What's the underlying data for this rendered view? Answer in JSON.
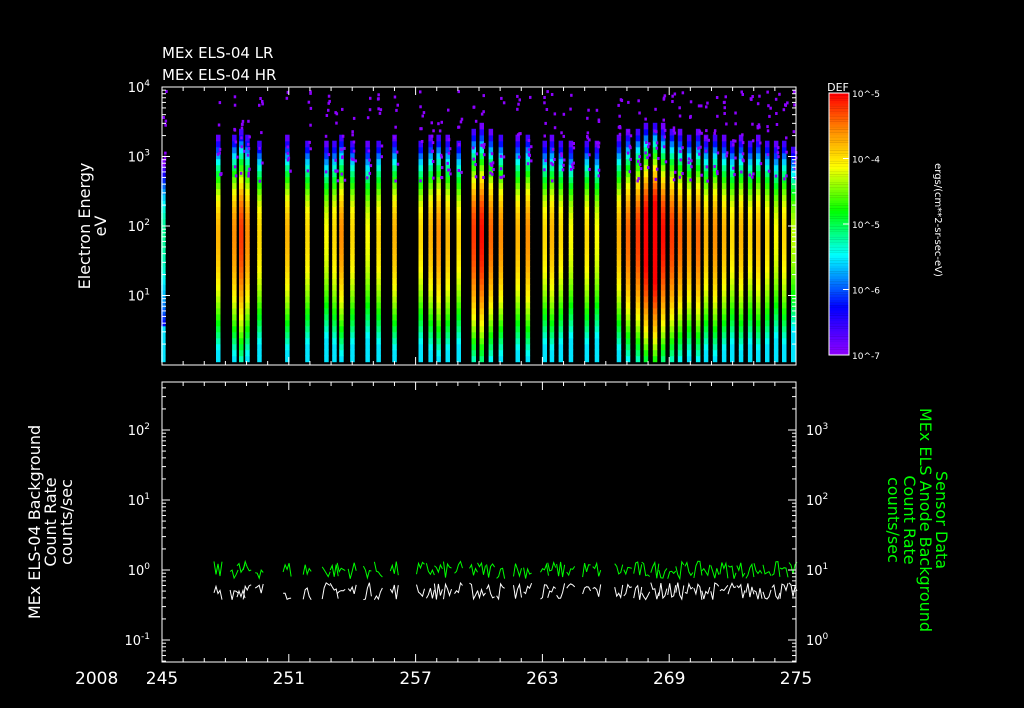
{
  "chart_data": [
    {
      "type": "heatmap",
      "title_lines": [
        "MEx ELS-04 LR",
        "MEx ELS-04 HR"
      ],
      "ylabel": "Electron Energy",
      "yunits": "eV",
      "yscale": "log",
      "ylim": [
        1,
        10000
      ],
      "yticks": [
        {
          "v": 10,
          "m": "10",
          "e": "1"
        },
        {
          "v": 100,
          "m": "10",
          "e": "2"
        },
        {
          "v": 1000,
          "m": "10",
          "e": "3"
        },
        {
          "v": 10000,
          "m": "10",
          "e": "4"
        }
      ],
      "xlim": [
        245,
        275
      ],
      "colorbar": {
        "title": "DEF",
        "units": "ergs/(cm**2-sr-sec-eV)",
        "scale": "log",
        "range": [
          1e-07,
          1e-05
        ],
        "ticks": [
          {
            "v": -7,
            "m": "10",
            "e": "-7"
          },
          {
            "v": -6,
            "m": "10",
            "e": "-6"
          },
          {
            "v": -5.5,
            "m": "10",
            "e": "-5"
          },
          {
            "v": -5,
            "m": "10",
            "e": "-5"
          }
        ],
        "tick_labels_shown": [
          "10^-7",
          "10^-6",
          "10^-5",
          "10^-4",
          "10^-5"
        ]
      },
      "passes_doy": [
        245.05,
        247.65,
        248.41,
        248.74,
        249.03,
        249.6,
        250.92,
        251.87,
        252.77,
        253.15,
        253.48,
        254.0,
        254.72,
        255.24,
        255.99,
        257.23,
        257.7,
        258.08,
        258.51,
        259.03,
        259.74,
        260.12,
        260.55,
        261.02,
        261.82,
        262.3,
        263.1,
        263.44,
        263.86,
        264.34,
        265.09,
        265.57,
        266.61,
        267.04,
        267.51,
        267.89,
        268.32,
        268.7,
        269.12,
        269.5,
        269.93,
        270.36,
        270.73,
        271.16,
        271.59,
        271.97,
        272.39,
        272.82,
        273.2,
        273.63,
        274.05,
        274.43,
        274.86
      ],
      "peak_def_log10": [
        -6.0,
        -5.2,
        -5.1,
        -4.9,
        -5.1,
        -5.3,
        -5.2,
        -5.3,
        -5.4,
        -5.3,
        -5.1,
        -5.3,
        -5.4,
        -5.3,
        -5.2,
        -5.3,
        -5.2,
        -5.1,
        -5.2,
        -5.3,
        -4.9,
        -4.8,
        -5.0,
        -5.1,
        -5.2,
        -5.1,
        -5.3,
        -5.2,
        -5.3,
        -5.4,
        -5.3,
        -5.4,
        -5.2,
        -5.0,
        -4.9,
        -4.7,
        -4.6,
        -4.8,
        -4.9,
        -5.0,
        -5.1,
        -5.0,
        -5.2,
        -5.1,
        -5.2,
        -5.3,
        -5.2,
        -5.3,
        -5.2,
        -5.3,
        -5.4,
        -5.3,
        -5.5
      ],
      "peak_energy_eV": 80
    },
    {
      "type": "line",
      "ylabel_left_lines": [
        "MEx ELS-04 Background",
        "Count Rate",
        "counts/sec"
      ],
      "ylabel_right_lines": [
        "Sensor Data",
        "MEx ELS Anode Background",
        "Count Rate",
        "counts/sec"
      ],
      "yscale": "log",
      "ylim_left": [
        0.05,
        500
      ],
      "ylim_right": [
        0.5,
        5000
      ],
      "yticks_left": [
        {
          "v": 0.1,
          "m": "10",
          "e": "-1"
        },
        {
          "v": 1,
          "m": "10",
          "e": "0"
        },
        {
          "v": 10,
          "m": "10",
          "e": "1"
        },
        {
          "v": 100,
          "m": "10",
          "e": "2"
        }
      ],
      "yticks_right": [
        {
          "v": 1,
          "m": "10",
          "e": "0"
        },
        {
          "v": 10,
          "m": "10",
          "e": "1"
        },
        {
          "v": 100,
          "m": "10",
          "e": "2"
        },
        {
          "v": 1000,
          "m": "10",
          "e": "3"
        }
      ],
      "xlabel_year": "2008",
      "xticks": [
        245,
        251,
        257,
        263,
        269,
        275
      ],
      "xlim": [
        245,
        275
      ],
      "series": [
        {
          "name": "ELS-04 Background",
          "axis": "left",
          "color": "#ffffff",
          "typical_value": 0.5
        },
        {
          "name": "Anode Background",
          "axis": "right",
          "color": "#00ff00",
          "typical_value": 10
        }
      ]
    }
  ]
}
